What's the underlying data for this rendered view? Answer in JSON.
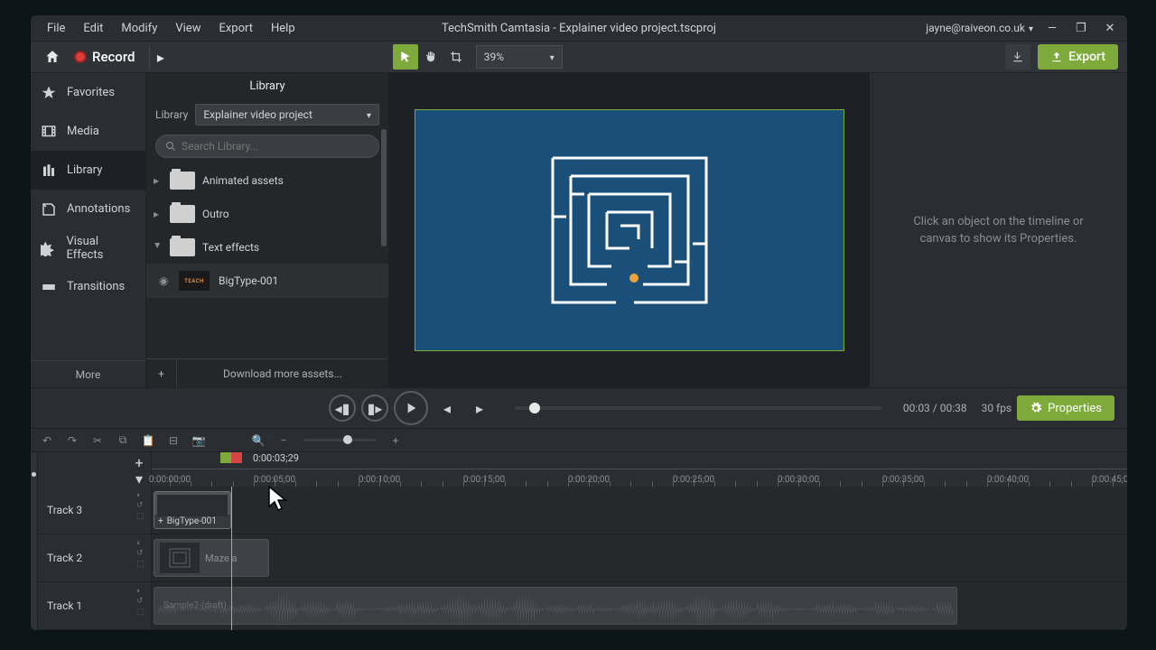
{
  "menubar": {
    "items": [
      "File",
      "Edit",
      "Modify",
      "View",
      "Export",
      "Help"
    ],
    "title": "TechSmith Camtasia - Explainer video project.tscproj",
    "account": "jayne@raiveon.co.uk"
  },
  "toolbar": {
    "record": "Record",
    "zoom": "39%",
    "export": "Export"
  },
  "sidebar": {
    "items": [
      "Favorites",
      "Media",
      "Library",
      "Annotations",
      "Visual Effects",
      "Transitions"
    ],
    "active": 2,
    "more": "More"
  },
  "library": {
    "title": "Library",
    "selector_label": "Library",
    "selector_value": "Explainer video project",
    "search_placeholder": "Search Library...",
    "folders": [
      "Animated assets",
      "Outro",
      "Text effects"
    ],
    "open_folder_index": 2,
    "asset_thumb_text": "TEACH",
    "asset_name": "BigType-001",
    "download_more": "Download more assets..."
  },
  "properties_hint": "Click an object on the timeline or canvas to show its Properties.",
  "playback": {
    "time": "00:03 / 00:38",
    "fps": "30 fps",
    "properties_btn": "Properties"
  },
  "timeline": {
    "playhead_time": "0:00:03;29",
    "ruler_labels": [
      "0:00:00;00",
      "0:00:05;00",
      "0:00:10;00",
      "0:00:15;00",
      "0:00:20;00",
      "0:00:25;00",
      "0:00:30;00",
      "0:00:35;00",
      "0:00:40;00",
      "0:00:45;00"
    ],
    "tracks": [
      "Track 3",
      "Track 2",
      "Track 1"
    ],
    "clip_bigtype": "BigType-001",
    "clip_maze": "Maze a",
    "clip_audio": "Sample2-(draft)"
  }
}
